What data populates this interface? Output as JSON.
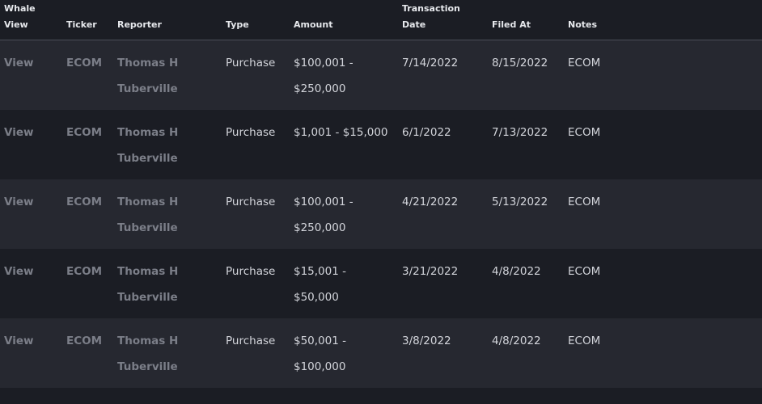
{
  "headers": {
    "whale_view": "Whale View",
    "ticker": "Ticker",
    "reporter": "Reporter",
    "type": "Type",
    "amount": "Amount",
    "transaction_date": "Transaction Date",
    "filed_at": "Filed At",
    "notes": "Notes"
  },
  "rows": [
    {
      "view": "View",
      "ticker": "ECOM",
      "reporter": "Thomas H Tuberville",
      "type": "Purchase",
      "amount": "$100,001 - $250,000",
      "transaction_date": "7/14/2022",
      "filed_at": "8/15/2022",
      "notes": "ECOM"
    },
    {
      "view": "View",
      "ticker": "ECOM",
      "reporter": "Thomas H Tuberville",
      "type": "Purchase",
      "amount": "$1,001 - $15,000",
      "transaction_date": "6/1/2022",
      "filed_at": "7/13/2022",
      "notes": "ECOM"
    },
    {
      "view": "View",
      "ticker": "ECOM",
      "reporter": "Thomas H Tuberville",
      "type": "Purchase",
      "amount": "$100,001 - $250,000",
      "transaction_date": "4/21/2022",
      "filed_at": "5/13/2022",
      "notes": "ECOM"
    },
    {
      "view": "View",
      "ticker": "ECOM",
      "reporter": "Thomas H Tuberville",
      "type": "Purchase",
      "amount": "$15,001 - $50,000",
      "transaction_date": "3/21/2022",
      "filed_at": "4/8/2022",
      "notes": "ECOM"
    },
    {
      "view": "View",
      "ticker": "ECOM",
      "reporter": "Thomas H Tuberville",
      "type": "Purchase",
      "amount": "$50,001 - $100,000",
      "transaction_date": "3/8/2022",
      "filed_at": "4/8/2022",
      "notes": "ECOM"
    }
  ],
  "colors": {
    "background": "#1b1d24",
    "row_alt": "#262830",
    "muted_text": "#7b7e88",
    "text": "#d3d5db",
    "header_text": "#e6e8ec",
    "divider": "#4a4d57"
  }
}
